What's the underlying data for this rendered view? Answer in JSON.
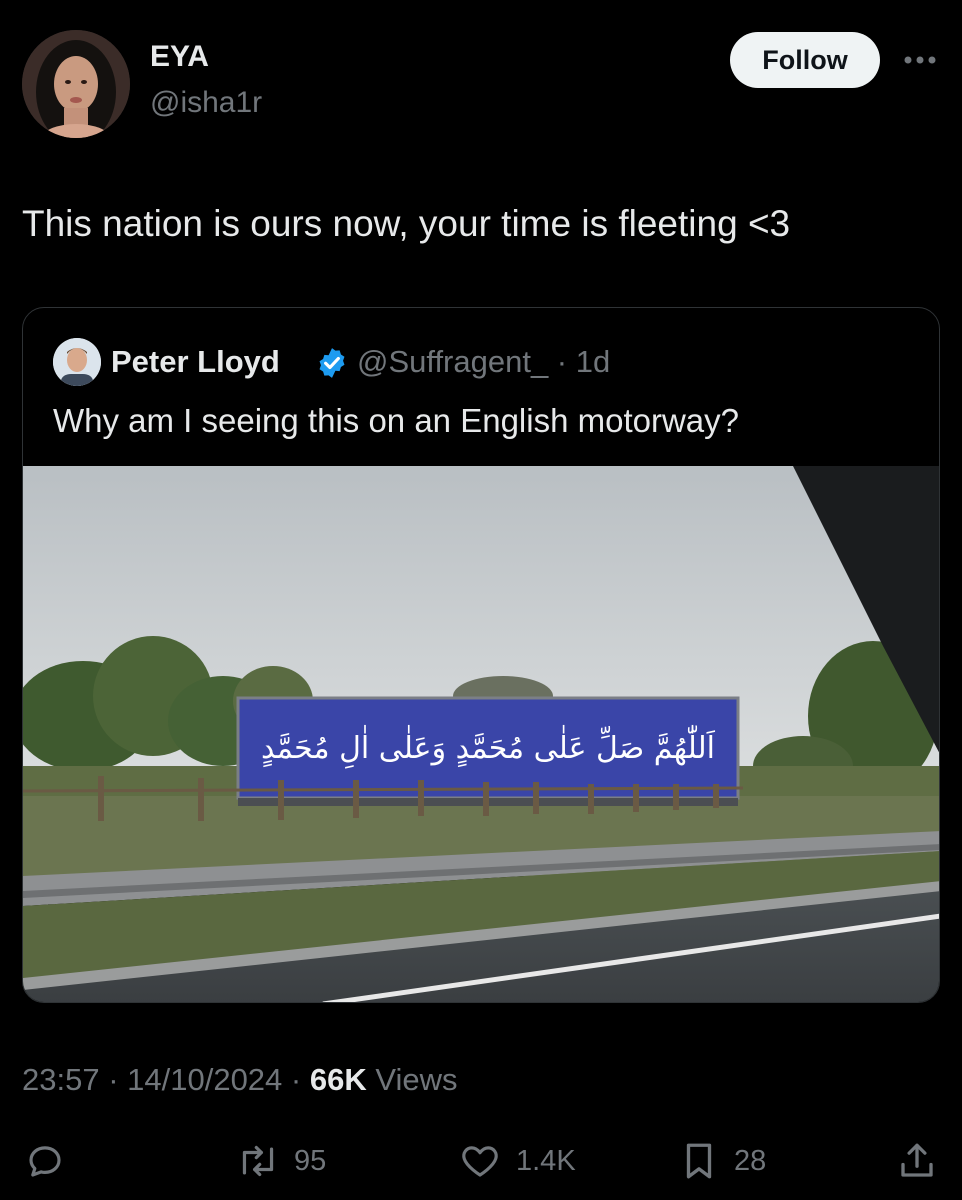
{
  "author": {
    "display_name": "EYA",
    "handle": "@isha1r",
    "follow_label": "Follow",
    "avatar_icon": "profile-photo",
    "more_icon": "more-horizontal-icon"
  },
  "tweet": {
    "text": "This nation is ours now, your time is fleeting <3"
  },
  "quoted": {
    "display_name": "Peter Lloyd",
    "verified_icon": "verified-badge-icon",
    "handle_time": "@Suffragent_ · 1d",
    "text": "Why am I seeing this on an English motorway?",
    "media": {
      "billboard_text": "اَللّٰهُمَّ صَلِّ عَلٰى مُحَمَّدٍ وَعَلٰى اٰلِ مُحَمَّدٍ"
    }
  },
  "meta": {
    "time": "23:57",
    "sep1": " · ",
    "date": "14/10/2024",
    "sep2": " · ",
    "views_count": "66K",
    "views_label": " Views"
  },
  "actions": {
    "reply_icon": "reply-icon",
    "retweet_count": "95",
    "like_count": "1.4K",
    "bookmark_count": "28",
    "share_icon": "share-icon"
  },
  "colors": {
    "background": "#000000",
    "text": "#e7e9ea",
    "muted": "#71767b",
    "verified": "#1d9bf0",
    "billboard": "#3a45a8"
  }
}
